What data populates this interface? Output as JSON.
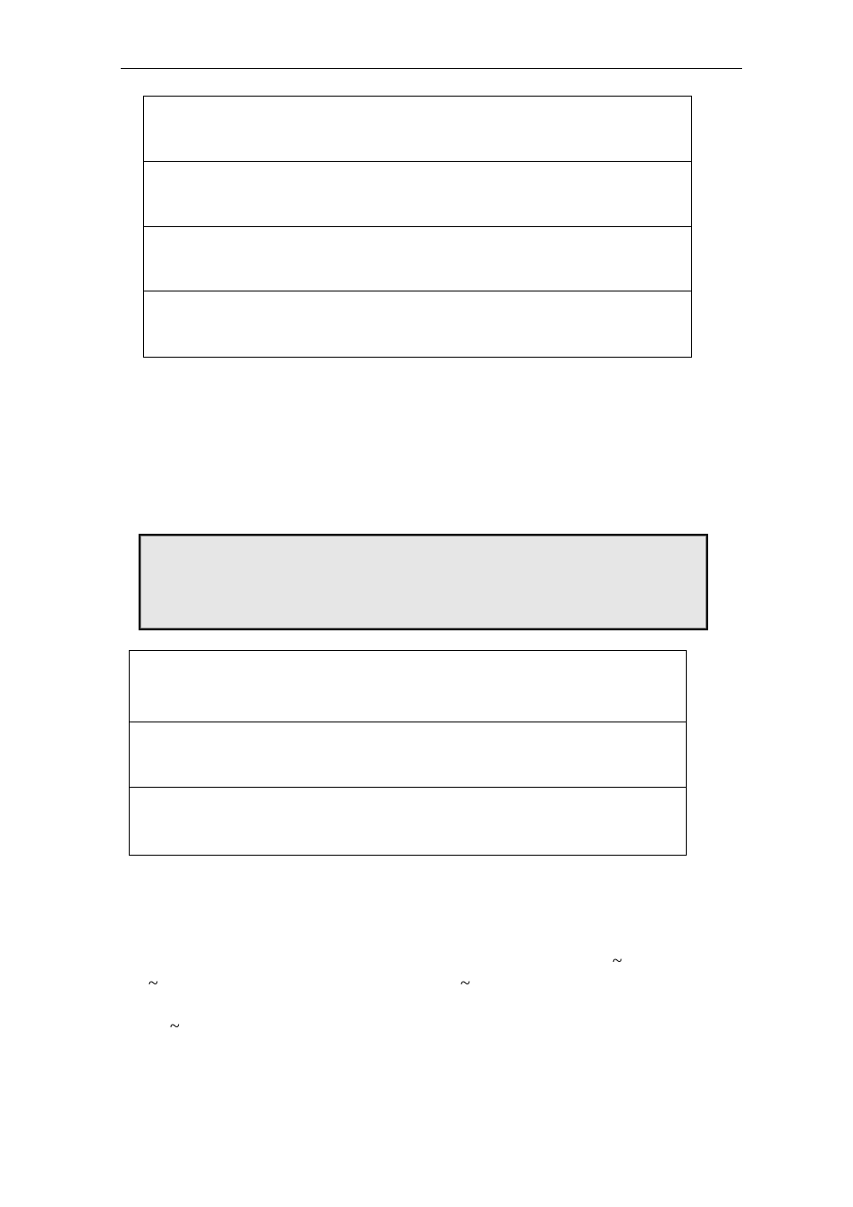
{
  "table1": {
    "rows": [
      {
        "content": ""
      },
      {
        "content": ""
      },
      {
        "content": ""
      },
      {
        "content": ""
      }
    ]
  },
  "shaded_box": {
    "content": ""
  },
  "table2": {
    "rows": [
      {
        "content": ""
      },
      {
        "content": ""
      },
      {
        "content": ""
      }
    ]
  },
  "tildes": {
    "t1": "~",
    "t2": "~",
    "t3": "~",
    "t4": "~"
  }
}
